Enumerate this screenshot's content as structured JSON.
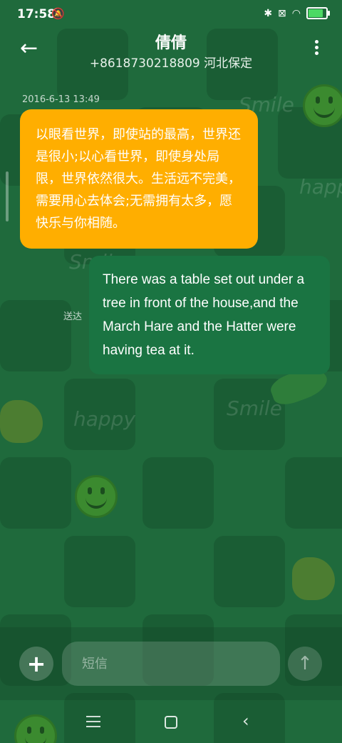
{
  "status_bar": {
    "time": "17:58",
    "icons": [
      "mute-bell-icon",
      "bluetooth-icon",
      "no-sim-icon",
      "wifi-icon",
      "battery-charging-icon"
    ]
  },
  "header": {
    "back_icon": "arrow-left-icon",
    "contact_name": "倩倩",
    "contact_detail": "+8618730218809 河北保定",
    "more_icon": "more-vertical-icon"
  },
  "conversation": {
    "timestamp": "2016-6-13 13:49",
    "received_message": "以眼看世界，即使站的最高，世界还是很小;以心看世界，即使身处局限，世界依然很大。生活远不完美，需要用心去体会;无需拥有太多，愿快乐与你相随。",
    "sent_message": "There was a table set out under a tree in front of the house,and the March Hare and the Hatter were having tea at it.",
    "sent_status": "送达"
  },
  "composer": {
    "add_icon": "plus-icon",
    "placeholder": "短信",
    "value": "",
    "send_icon": "arrow-up-icon"
  },
  "nav_bar": {
    "icons": [
      "menu-icon",
      "home-icon",
      "back-icon"
    ]
  },
  "colors": {
    "background": "#1f6a3c",
    "received_bubble": "#ffae00",
    "sent_bubble": "#1a7442"
  }
}
